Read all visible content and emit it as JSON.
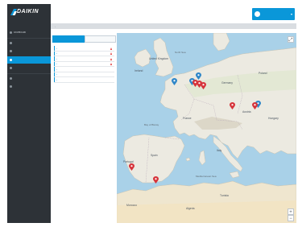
{
  "brand": {
    "name": "DAIKIN",
    "tagline": "",
    "accent": "#0a97d9",
    "sidebar_bg": "#2d3237"
  },
  "sidebar": {
    "items": [
      {
        "label": "Dashboard",
        "icon": "home-icon",
        "active": false
      },
      {
        "label": "",
        "icon": "dot-icon",
        "active": false
      },
      {
        "label": "",
        "icon": "dot-icon",
        "active": false
      },
      {
        "label": "",
        "icon": "dot-icon",
        "active": true
      },
      {
        "label": "",
        "icon": "dot-icon",
        "active": false
      },
      {
        "label": "",
        "icon": "dot-icon",
        "active": false
      },
      {
        "label": "",
        "icon": "dot-icon",
        "active": false
      }
    ],
    "footer": [
      "",
      "",
      "",
      "",
      ""
    ]
  },
  "header": {
    "user_name": "",
    "user_caret": "▾"
  },
  "breadcrumb": {
    "root": "",
    "separator": "›",
    "current": ""
  },
  "panel": {
    "tabs": [
      {
        "label": "",
        "active": true
      },
      {
        "label": "",
        "active": false
      }
    ],
    "sites": [
      {
        "name": "",
        "alarm": true
      },
      {
        "name": "",
        "alarm": true
      },
      {
        "name": "",
        "alarm": true
      },
      {
        "name": "",
        "alarm": true
      },
      {
        "name": "",
        "alarm": false
      },
      {
        "name": "",
        "alarm": false
      },
      {
        "name": "",
        "alarm": false
      }
    ]
  },
  "map": {
    "controls": {
      "fullscreen": "⤢",
      "zoom_in": "+",
      "zoom_out": "−"
    },
    "labels": {
      "north_sea": "North Sea",
      "united_kingdom": "United Kingdom",
      "ireland": "Ireland",
      "germany": "Germany",
      "poland": "Poland",
      "france": "France",
      "austria": "Austria",
      "hungary": "Hungary",
      "italy": "Italy",
      "spain": "Spain",
      "portugal": "Portugal",
      "morocco": "Morocco",
      "algeria": "Algeria",
      "tunisia": "Tunisia",
      "mediterranean": "Mediterranean Sea",
      "bay_of_biscay": "Bay of Biscay"
    },
    "attribution": "",
    "pins": [
      {
        "color": "#2f86c8",
        "site": "blue"
      },
      {
        "color": "#2f86c8",
        "site": "blue"
      },
      {
        "color": "#2f86c8",
        "site": "blue"
      },
      {
        "color": "#2f86c8",
        "site": "blue"
      },
      {
        "color": "#d6333a",
        "site": "red"
      },
      {
        "color": "#d6333a",
        "site": "red"
      },
      {
        "color": "#d6333a",
        "site": "red"
      },
      {
        "color": "#d6333a",
        "site": "red"
      },
      {
        "color": "#d6333a",
        "site": "red"
      },
      {
        "color": "#d6333a",
        "site": "red"
      },
      {
        "color": "#d6333a",
        "site": "red"
      }
    ]
  }
}
